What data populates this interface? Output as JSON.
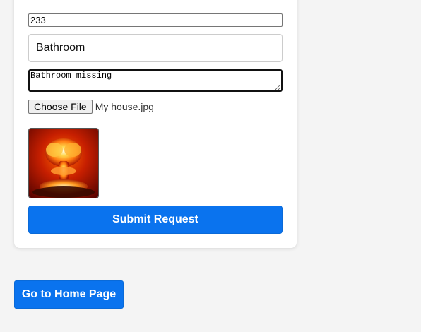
{
  "form": {
    "unit_number": "233",
    "room": "Bathroom",
    "description": "Bathroom missing",
    "file_button_label": "Choose File",
    "file_name": "My house.jpg",
    "submit_label": "Submit Request"
  },
  "nav": {
    "home_label": "Go to Home Page"
  },
  "colors": {
    "primary_button": "#0a73ee",
    "page_background": "#f4f4f4"
  }
}
